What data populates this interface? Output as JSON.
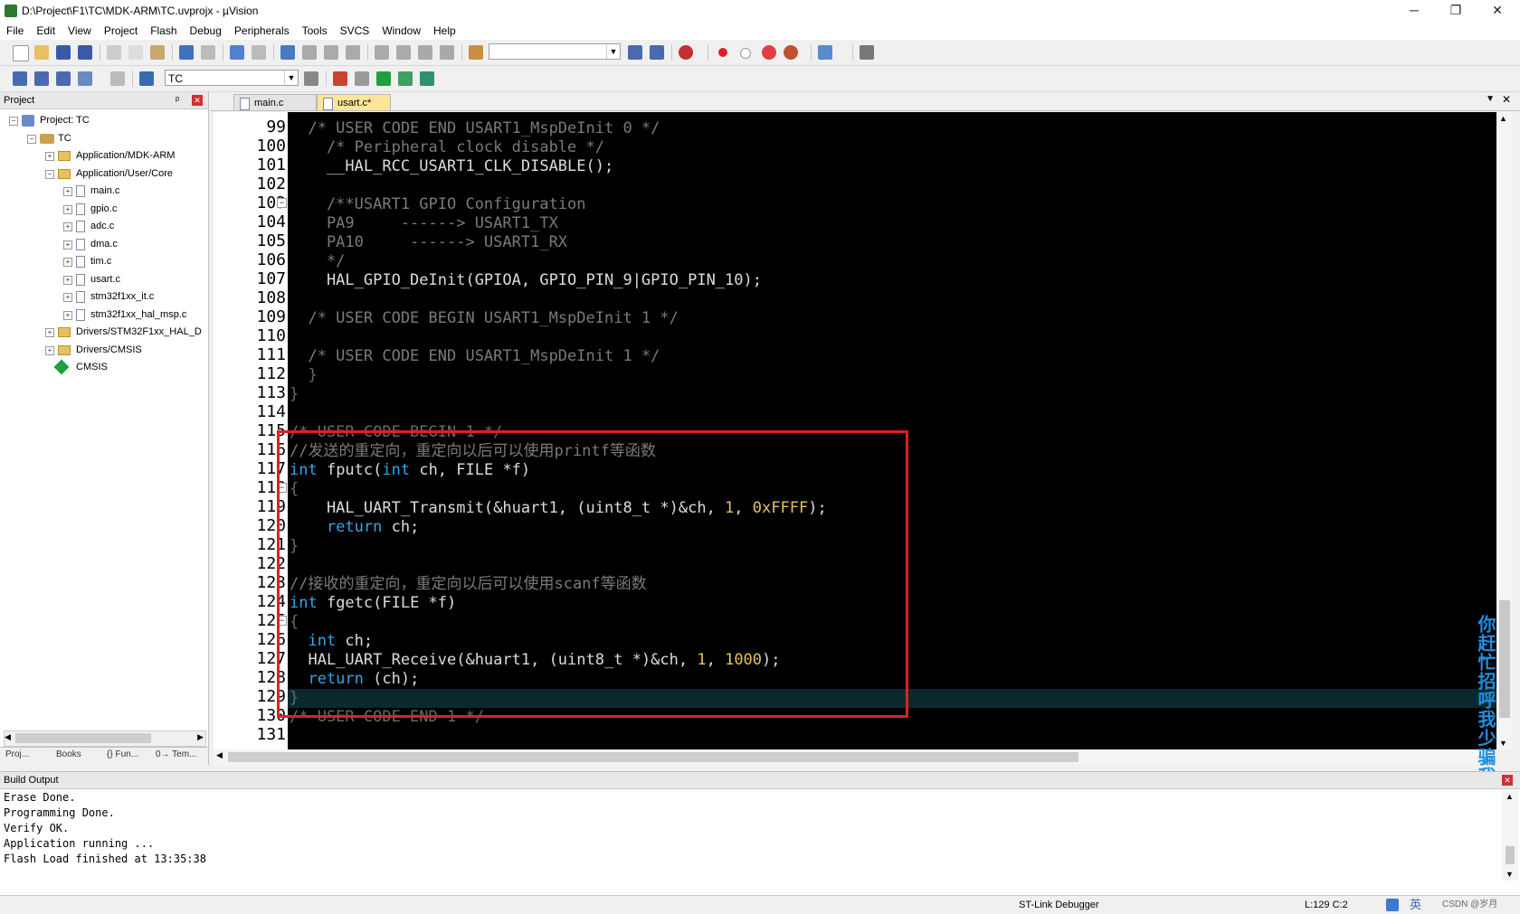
{
  "window": {
    "title": "D:\\Project\\F1\\TC\\MDK-ARM\\TC.uvprojx - µVision",
    "minimize": "─",
    "restore": "❐",
    "close": "✕"
  },
  "menu": [
    "File",
    "Edit",
    "View",
    "Project",
    "Flash",
    "Debug",
    "Peripherals",
    "Tools",
    "SVCS",
    "Window",
    "Help"
  ],
  "toolbar2": {
    "target": "TC"
  },
  "project": {
    "header": "Project",
    "pin": "ᵖ",
    "close": "✕",
    "tree": [
      {
        "label": "Project: TC",
        "level": 0,
        "type": "project",
        "expander": "⊟"
      },
      {
        "label": "TC",
        "level": 1,
        "type": "target",
        "expander": "⊟"
      },
      {
        "label": "Application/MDK-ARM",
        "level": 2,
        "type": "folder",
        "expander": "⊞"
      },
      {
        "label": "Application/User/Core",
        "level": 2,
        "type": "folder",
        "expander": "⊟"
      },
      {
        "label": "main.c",
        "level": 3,
        "type": "file",
        "expander": "⊞"
      },
      {
        "label": "gpio.c",
        "level": 3,
        "type": "file",
        "expander": "⊞"
      },
      {
        "label": "adc.c",
        "level": 3,
        "type": "file",
        "expander": "⊞"
      },
      {
        "label": "dma.c",
        "level": 3,
        "type": "file",
        "expander": "⊞"
      },
      {
        "label": "tim.c",
        "level": 3,
        "type": "file",
        "expander": "⊞"
      },
      {
        "label": "usart.c",
        "level": 3,
        "type": "file",
        "expander": "⊞"
      },
      {
        "label": "stm32f1xx_it.c",
        "level": 3,
        "type": "file",
        "expander": "⊞"
      },
      {
        "label": "stm32f1xx_hal_msp.c",
        "level": 3,
        "type": "file",
        "expander": "⊞"
      },
      {
        "label": "Drivers/STM32F1xx_HAL_D",
        "level": 2,
        "type": "folder",
        "expander": "⊞"
      },
      {
        "label": "Drivers/CMSIS",
        "level": 2,
        "type": "folder",
        "expander": "⊞"
      },
      {
        "label": "CMSIS",
        "level": 2,
        "type": "cmsis",
        "expander": ""
      }
    ],
    "bottom_tabs": [
      "Proj...",
      "Books",
      "{} Fun...",
      "0→ Tem..."
    ]
  },
  "editor": {
    "tabs": [
      {
        "label": "main.c",
        "active": false
      },
      {
        "label": "usart.c*",
        "active": true
      }
    ],
    "lines": [
      {
        "n": "99",
        "segs": [
          [
            "c-comment",
            "  /* USER CODE END USART1_MspDeInit 0 */"
          ]
        ]
      },
      {
        "n": "100",
        "segs": [
          [
            "c-comment",
            "    /* Peripheral clock disable */"
          ]
        ]
      },
      {
        "n": "101",
        "segs": [
          [
            "c-id",
            "    __HAL_RCC_USART1_CLK_DISABLE();"
          ]
        ]
      },
      {
        "n": "102",
        "segs": [
          [
            "c-id",
            ""
          ]
        ]
      },
      {
        "n": "103",
        "segs": [
          [
            "c-comment",
            "    /**USART1 GPIO Configuration"
          ]
        ]
      },
      {
        "n": "104",
        "segs": [
          [
            "c-comment",
            "    PA9     ------> USART1_TX"
          ]
        ]
      },
      {
        "n": "105",
        "segs": [
          [
            "c-comment",
            "    PA10     ------> USART1_RX"
          ]
        ]
      },
      {
        "n": "106",
        "segs": [
          [
            "c-comment",
            "    */"
          ]
        ]
      },
      {
        "n": "107",
        "segs": [
          [
            "c-id",
            "    HAL_GPIO_DeInit(GPIOA, GPIO_PIN_9|GPIO_PIN_10);"
          ]
        ]
      },
      {
        "n": "108",
        "segs": [
          [
            "c-id",
            ""
          ]
        ]
      },
      {
        "n": "109",
        "segs": [
          [
            "c-comment",
            "  /* USER CODE BEGIN USART1_MspDeInit 1 */"
          ]
        ]
      },
      {
        "n": "110",
        "segs": [
          [
            "c-id",
            ""
          ]
        ]
      },
      {
        "n": "111",
        "segs": [
          [
            "c-comment",
            "  /* USER CODE END USART1_MspDeInit 1 */"
          ]
        ]
      },
      {
        "n": "112",
        "segs": [
          [
            "c-dim",
            "  }"
          ]
        ]
      },
      {
        "n": "113",
        "segs": [
          [
            "c-dim",
            "}"
          ]
        ]
      },
      {
        "n": "114",
        "segs": [
          [
            "c-id",
            ""
          ]
        ]
      },
      {
        "n": "115",
        "segs": [
          [
            "c-dim",
            "/* USER CODE BEGIN 1 */"
          ]
        ]
      },
      {
        "n": "116",
        "segs": [
          [
            "c-comment",
            "//发送的重定向，重定向以后可以使用printf等函数"
          ]
        ]
      },
      {
        "n": "117",
        "segs": [
          [
            "c-kw",
            "int"
          ],
          [
            "c-id",
            " fputc("
          ],
          [
            "c-kw",
            "int"
          ],
          [
            "c-id",
            " ch, FILE *f)"
          ]
        ]
      },
      {
        "n": "118",
        "segs": [
          [
            "c-dim",
            "{"
          ]
        ]
      },
      {
        "n": "119",
        "segs": [
          [
            "c-id",
            "    HAL_UART_Transmit(&huart1, (uint8_t *)&ch, "
          ],
          [
            "c-num",
            "1"
          ],
          [
            "c-id",
            ", "
          ],
          [
            "c-num",
            "0xFFFF"
          ],
          [
            "c-id",
            ");"
          ]
        ]
      },
      {
        "n": "120",
        "segs": [
          [
            "c-kw",
            "    return"
          ],
          [
            "c-id",
            " ch;"
          ]
        ]
      },
      {
        "n": "121",
        "segs": [
          [
            "c-dim",
            "}"
          ]
        ]
      },
      {
        "n": "122",
        "segs": [
          [
            "c-id",
            ""
          ]
        ]
      },
      {
        "n": "123",
        "segs": [
          [
            "c-comment",
            "//接收的重定向，重定向以后可以使用scanf等函数"
          ]
        ]
      },
      {
        "n": "124",
        "segs": [
          [
            "c-kw",
            "int"
          ],
          [
            "c-id",
            " fgetc(FILE *f)"
          ]
        ]
      },
      {
        "n": "125",
        "segs": [
          [
            "c-dim",
            "{"
          ]
        ]
      },
      {
        "n": "126",
        "segs": [
          [
            "c-kw",
            "  int"
          ],
          [
            "c-id",
            " ch;"
          ]
        ]
      },
      {
        "n": "127",
        "segs": [
          [
            "c-id",
            "  HAL_UART_Receive(&huart1, (uint8_t *)&ch, "
          ],
          [
            "c-num",
            "1"
          ],
          [
            "c-id",
            ", "
          ],
          [
            "c-num",
            "1000"
          ],
          [
            "c-id",
            ");"
          ]
        ]
      },
      {
        "n": "128",
        "segs": [
          [
            "c-kw",
            "  return"
          ],
          [
            "c-id",
            " (ch);"
          ]
        ]
      },
      {
        "n": "129",
        "segs": [
          [
            "c-dim",
            "}"
          ]
        ]
      },
      {
        "n": "130",
        "segs": [
          [
            "c-dim",
            "/* USER CODE END 1 */"
          ]
        ]
      },
      {
        "n": "131",
        "segs": [
          [
            "c-id",
            ""
          ]
        ]
      }
    ],
    "current_line": "129"
  },
  "build": {
    "header": "Build Output",
    "lines": [
      "Erase Done.",
      "Programming Done.",
      "Verify OK.",
      "Application running ...",
      "Flash Load finished at 13:35:38"
    ]
  },
  "status": {
    "debugger": "ST-Link Debugger",
    "cursor": "L:129 C:2",
    "ime": "英",
    "watermark": "CSDN @岁月"
  },
  "overlay_text": "你赶忙招呼我少骗我",
  "colors": {
    "code_bg": "#000000",
    "annotation": "#e02020",
    "keyword": "#2fa8e8",
    "number": "#e8c060"
  }
}
